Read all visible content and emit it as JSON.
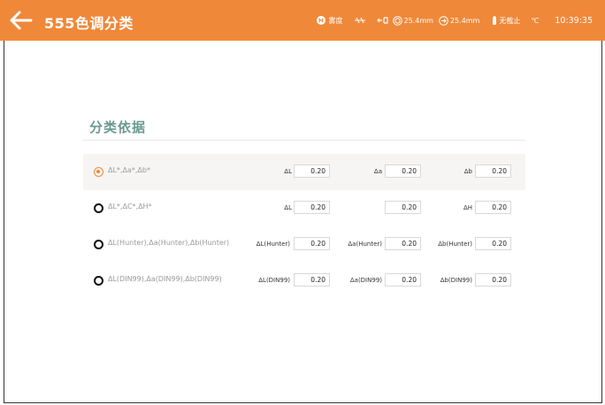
{
  "header": {
    "title": "555色调分类",
    "fog_label": "雾度",
    "aperture_1": "25.4mm",
    "aperture_2": "25.4mm",
    "no_cutoff": "无截止",
    "temp_unit": "℃",
    "time": "10:39:35"
  },
  "section": {
    "title": "分类依据"
  },
  "options": [
    {
      "label": "ΔL*,Δa*,Δb*",
      "selected": true,
      "fields": [
        {
          "label": "ΔL",
          "value": "0.20"
        },
        {
          "label": "Δa",
          "value": "0.20"
        },
        {
          "label": "Δb",
          "value": "0.20"
        }
      ]
    },
    {
      "label": "ΔL*,ΔC*,ΔH*",
      "selected": false,
      "fields": [
        {
          "label": "ΔL",
          "value": "0.20"
        },
        {
          "label": "",
          "value": "0.20"
        },
        {
          "label": "ΔH",
          "value": "0.20"
        }
      ]
    },
    {
      "label": "ΔL(Hunter),Δa(Hunter),Δb(Hunter)",
      "selected": false,
      "fields": [
        {
          "label": "ΔL(Hunter)",
          "value": "0.20"
        },
        {
          "label": "Δa(Hunter)",
          "value": "0.20"
        },
        {
          "label": "Δb(Hunter)",
          "value": "0.20"
        }
      ]
    },
    {
      "label": "ΔL(DIN99),Δa(DIN99),Δb(DIN99)",
      "selected": false,
      "fields": [
        {
          "label": "ΔL(DIN99)",
          "value": "0.20"
        },
        {
          "label": "Δa(DIN99)",
          "value": "0.20"
        },
        {
          "label": "Δb(DIN99)",
          "value": "0.20"
        }
      ]
    }
  ],
  "colors": {
    "accent": "#f0883a",
    "section_title": "#6a9a92"
  }
}
